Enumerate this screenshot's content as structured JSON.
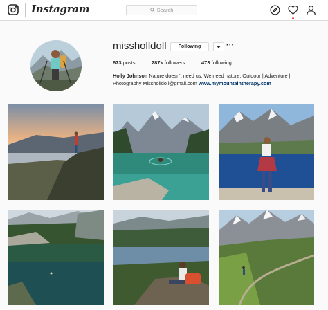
{
  "header": {
    "wordmark": "Instagram",
    "search_placeholder": "Search",
    "notification_color": "#ed4956"
  },
  "profile": {
    "username": "missholldoll",
    "following_button": "Following",
    "more_label": "···",
    "stats": {
      "posts_count": "673",
      "posts_label": "posts",
      "followers_count": "287k",
      "followers_label": "followers",
      "following_count": "473",
      "following_label": "following"
    },
    "bio": {
      "name": "Holly Johnson",
      "line1_rest": "Nature doesn't need us. We need nature. Outdoor | Adventure |",
      "line2": "Photography Missholldoll@gmail.com",
      "link": "www.mymountaintherapy.com"
    }
  },
  "posts": [
    {
      "scene": "sunset-cliff"
    },
    {
      "scene": "mountain-lake-swimmer"
    },
    {
      "scene": "hiker-glacier-lake"
    },
    {
      "scene": "forest-lake"
    },
    {
      "scene": "valley-lake-sitter"
    },
    {
      "scene": "alpine-trail"
    }
  ],
  "icons": [
    "instagram-camera-icon",
    "search-icon",
    "explore-compass-icon",
    "heart-icon",
    "profile-icon",
    "chevron-down-icon"
  ]
}
